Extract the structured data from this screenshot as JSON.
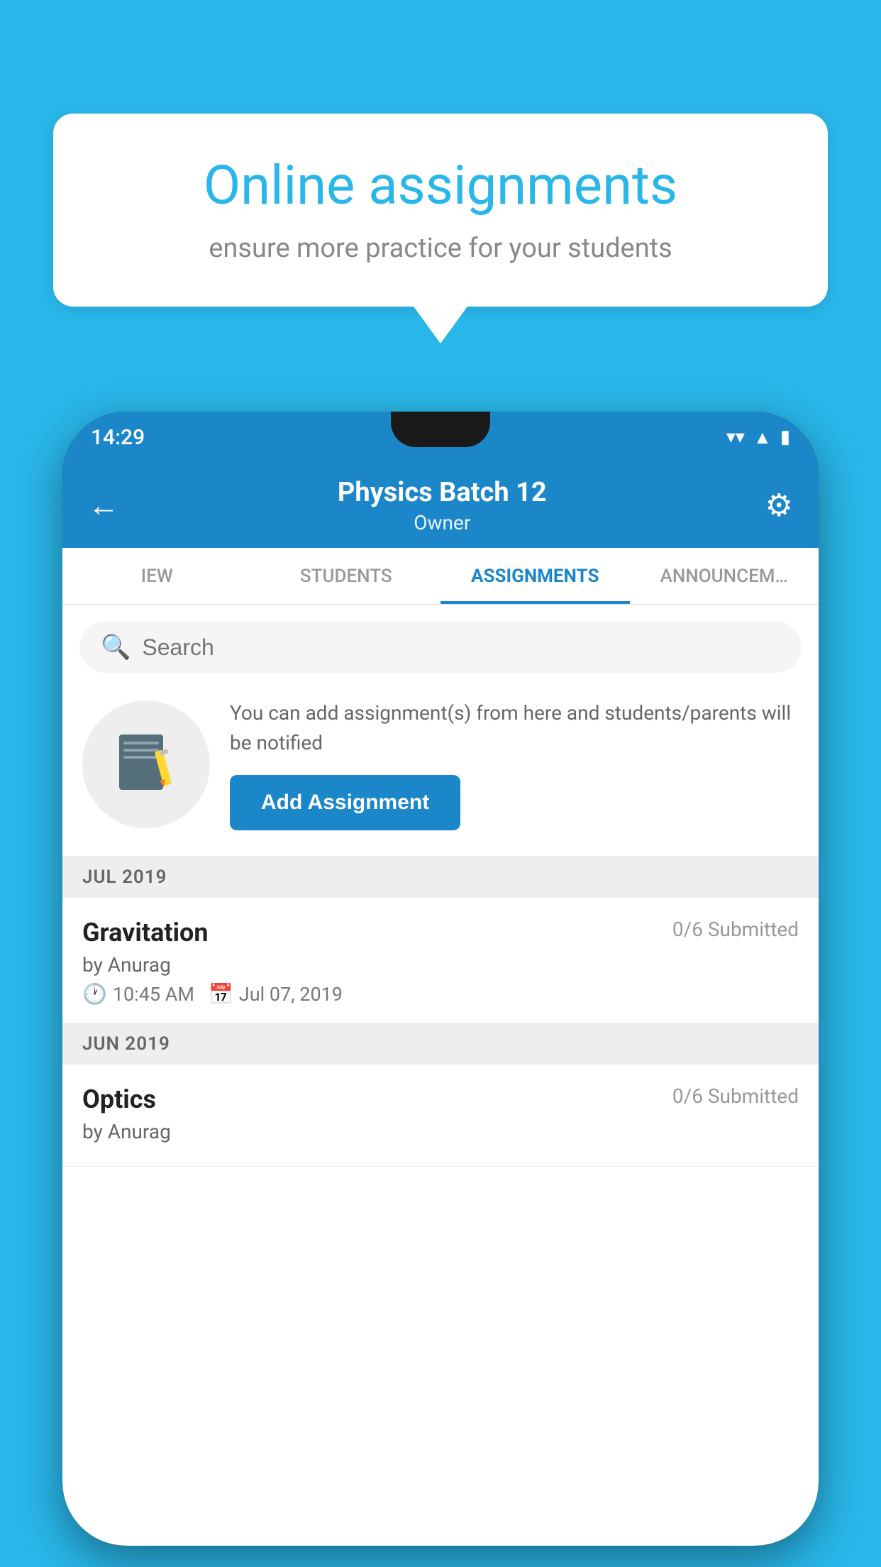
{
  "background_color": "#29B6E8",
  "speech_bubble": {
    "title": "Online assignments",
    "subtitle": "ensure more practice for your students"
  },
  "status_bar": {
    "time": "14:29",
    "wifi": "▼",
    "signal": "▲",
    "battery": "▮"
  },
  "app_header": {
    "title": "Physics Batch 12",
    "subtitle": "Owner",
    "back_label": "←",
    "settings_label": "⚙"
  },
  "tabs": [
    {
      "label": "IEW",
      "active": false
    },
    {
      "label": "STUDENTS",
      "active": false
    },
    {
      "label": "ASSIGNMENTS",
      "active": true
    },
    {
      "label": "ANNOUNCEM…",
      "active": false
    }
  ],
  "search": {
    "placeholder": "Search"
  },
  "add_assignment_section": {
    "description": "You can add assignment(s) from here and students/parents will be notified",
    "button_label": "Add Assignment"
  },
  "sections": [
    {
      "month_label": "JUL 2019",
      "assignments": [
        {
          "name": "Gravitation",
          "submitted": "0/6 Submitted",
          "by": "by Anurag",
          "time": "10:45 AM",
          "date": "Jul 07, 2019"
        }
      ]
    },
    {
      "month_label": "JUN 2019",
      "assignments": [
        {
          "name": "Optics",
          "submitted": "0/6 Submitted",
          "by": "by Anurag",
          "time": "",
          "date": ""
        }
      ]
    }
  ]
}
